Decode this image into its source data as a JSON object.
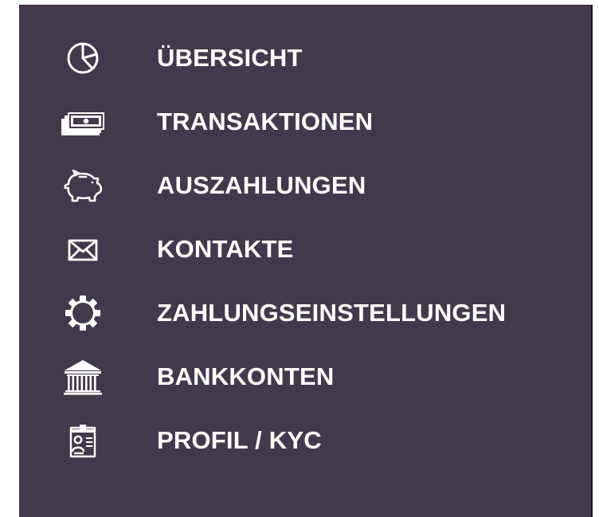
{
  "sidebar": {
    "items": [
      {
        "label": "ÜBERSICHT",
        "icon": "pie-chart-icon"
      },
      {
        "label": "TRANSAKTIONEN",
        "icon": "money-stack-icon"
      },
      {
        "label": "AUSZAHLUNGEN",
        "icon": "piggy-bank-icon"
      },
      {
        "label": "KONTAKTE",
        "icon": "envelope-icon"
      },
      {
        "label": "ZAHLUNGSEINSTELLUNGEN",
        "icon": "gear-icon"
      },
      {
        "label": "BANKKONTEN",
        "icon": "bank-building-icon"
      },
      {
        "label": "PROFIL / KYC",
        "icon": "id-card-icon"
      }
    ]
  },
  "colors": {
    "sidebar_background": "#43394c",
    "text": "#ffffff",
    "icon": "#ffffff"
  }
}
